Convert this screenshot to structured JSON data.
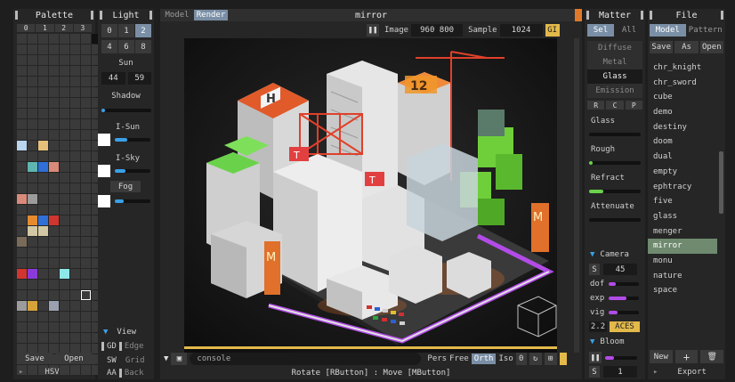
{
  "palette": {
    "title": "Palette",
    "pages": [
      "0",
      "1",
      "2",
      "3"
    ],
    "save": "Save",
    "open": "Open",
    "hsv": "HSV",
    "colors": {
      "lightblue": "#b9d4ec",
      "tan": "#e6c07a",
      "teal": "#5fb6b0",
      "blue": "#2f6fd6",
      "salmon": "#d98a7a",
      "orange": "#e68a2e",
      "gray": "#9c9c9c",
      "red": "#d0352f",
      "purple": "#8a3ad8",
      "cyan": "#8ee8e8",
      "khaki": "#d2c9a4",
      "gold": "#d6a23a",
      "steel": "#9aa0b0"
    }
  },
  "light": {
    "title": "Light",
    "row1": [
      "0",
      "1",
      "2"
    ],
    "row2": [
      "4",
      "6",
      "8"
    ],
    "sun": "Sun",
    "sun_values": [
      "44",
      "59"
    ],
    "shadow": "Shadow",
    "isun": "I-Sun",
    "isky": "I-Sky",
    "fog": "Fog",
    "view": "View",
    "gd": "GD",
    "edge": "Edge",
    "sw": "SW",
    "grid": "Grid",
    "aa": "AA",
    "back": "Back"
  },
  "viewport": {
    "tab_model": "Model",
    "tab_render": "Render",
    "title": "mirror",
    "image_label": "Image",
    "image_size": "960 800",
    "sample_label": "Sample",
    "sample_value": "1024",
    "gi": "GI",
    "console_placeholder": "console",
    "modes": [
      "Pers",
      "Free",
      "Orth",
      "Iso"
    ],
    "zero": "0",
    "hint": "Rotate [RButton] : Move [MButton]",
    "scene_text": {
      "helipad": "H",
      "sign1": "12",
      "sign2": "T",
      "sign3": "T",
      "m1": "M",
      "m2": "M"
    }
  },
  "matter": {
    "title": "Matter",
    "sel": "Sel",
    "all": "All",
    "types": [
      "Diffuse",
      "Metal",
      "Glass",
      "Emission"
    ],
    "rcp": [
      "R",
      "C",
      "P"
    ],
    "props": [
      "Glass",
      "Rough",
      "Refract",
      "Attenuate"
    ],
    "camera": "Camera",
    "s_label": "S",
    "s_value": "45",
    "dof": "dof",
    "exp": "exp",
    "vig": "vig",
    "gamma": "2.2",
    "aces": "ACES",
    "bloom": "Bloom",
    "s2_label": "S",
    "s2_value": "1"
  },
  "file": {
    "title": "File",
    "tab_model": "Model",
    "tab_pattern": "Pattern",
    "save": "Save",
    "as": "As",
    "open": "Open",
    "items": [
      "chr_knight",
      "chr_sword",
      "cube",
      "demo",
      "destiny",
      "doom",
      "dual",
      "empty",
      "ephtracy",
      "five",
      "glass",
      "menger",
      "mirror",
      "monu",
      "nature",
      "space"
    ],
    "selected": "mirror",
    "new": "New",
    "plus": "+",
    "export": "Export"
  }
}
